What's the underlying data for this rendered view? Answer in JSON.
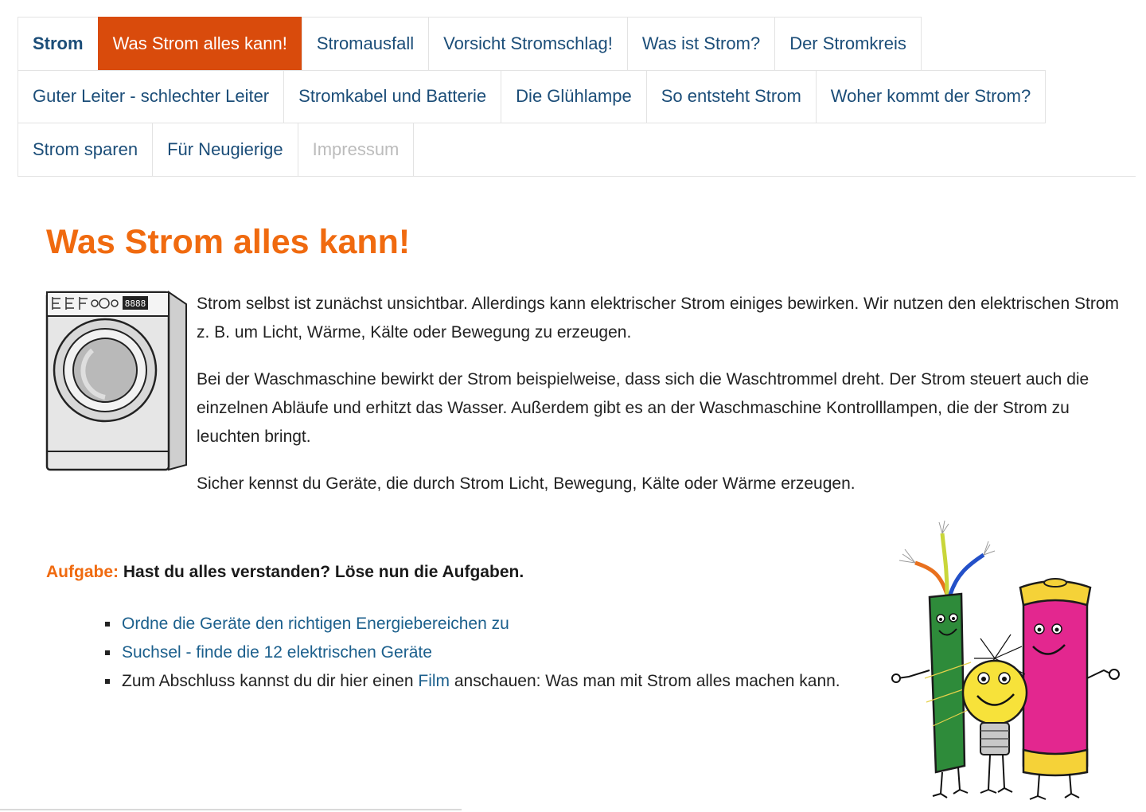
{
  "nav": {
    "tabs": [
      {
        "label": "Strom",
        "state": "home"
      },
      {
        "label": "Was Strom alles kann!",
        "state": "active"
      },
      {
        "label": "Stromausfall",
        "state": "normal"
      },
      {
        "label": "Vorsicht Stromschlag!",
        "state": "normal"
      },
      {
        "label": "Was ist Strom?",
        "state": "normal"
      },
      {
        "label": "Der Stromkreis",
        "state": "normal"
      },
      {
        "label": "Guter Leiter - schlechter Leiter",
        "state": "normal"
      },
      {
        "label": "Stromkabel und Batterie",
        "state": "normal"
      },
      {
        "label": "Die Glühlampe",
        "state": "normal"
      },
      {
        "label": "So entsteht Strom",
        "state": "normal"
      },
      {
        "label": "Woher kommt der Strom?",
        "state": "normal"
      },
      {
        "label": "Strom sparen",
        "state": "normal"
      },
      {
        "label": "Für Neugierige",
        "state": "normal"
      },
      {
        "label": "Impressum",
        "state": "disabled"
      }
    ]
  },
  "content": {
    "title": "Was Strom alles kann!",
    "washer_display": "8888",
    "paragraphs": [
      "Strom selbst ist zunächst unsichtbar. Allerdings kann elektrischer Strom einiges bewirken. Wir nutzen den elektrischen Strom z. B. um Licht, Wärme, Kälte oder Bewegung zu erzeugen.",
      "Bei der Waschmaschine bewirkt der Strom beispielweise, dass sich die Waschtrommel dreht. Der Strom steuert auch die einzelnen Abläufe und erhitzt das Wasser. Außerdem gibt es an der Waschmaschine Kontrolllampen, die der Strom zu leuchten bringt.",
      "Sicher kennst du Geräte, die durch Strom Licht, Bewegung, Kälte oder Wärme erzeugen."
    ],
    "task": {
      "label": "Aufgabe:",
      "text": "Hast du alles verstanden? Löse nun die Aufgaben."
    },
    "task_items": {
      "item1_link": "Ordne die Geräte den richtigen Energiebereichen zu",
      "item2_link": "Suchsel - finde die 12 elektrischen Geräte",
      "item3_before": "Zum Abschluss kannst du dir hier einen ",
      "item3_link": "Film",
      "item3_after": " anschauen: Was man mit Strom alles machen kann."
    }
  },
  "colors": {
    "active_tab": "#d94b0c",
    "title": "#f06a0f",
    "link": "#1b5f8c",
    "nav_text": "#1b4d78"
  },
  "icons": [
    "washing-machine-illustration",
    "electricity-mascots-illustration"
  ]
}
